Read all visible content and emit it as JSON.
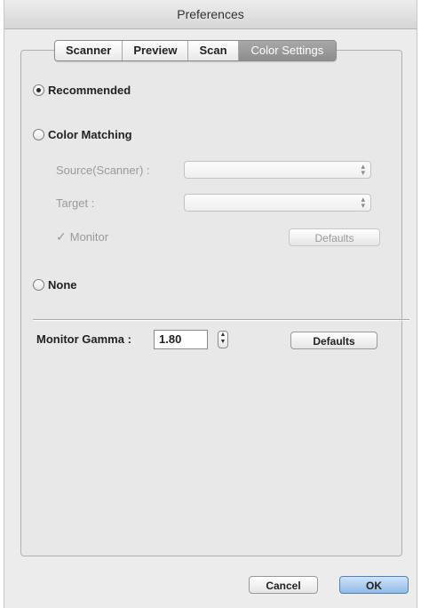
{
  "window": {
    "title": "Preferences"
  },
  "tabs": [
    {
      "label": "Scanner",
      "selected": false
    },
    {
      "label": "Preview",
      "selected": false
    },
    {
      "label": "Scan",
      "selected": false
    },
    {
      "label": "Color Settings",
      "selected": true
    }
  ],
  "color_settings": {
    "recommended": {
      "label": "Recommended",
      "selected": true
    },
    "color_matching": {
      "label": "Color Matching",
      "selected": false,
      "source_label": "Source(Scanner) :",
      "source_value": "",
      "target_label": "Target :",
      "target_value": "",
      "monitor_label": "Monitor",
      "monitor_checked": true,
      "defaults_label": "Defaults"
    },
    "none": {
      "label": "None",
      "selected": false
    }
  },
  "gamma": {
    "label": "Monitor Gamma :",
    "value": "1.80",
    "defaults_label": "Defaults"
  },
  "footer": {
    "cancel_label": "Cancel",
    "ok_label": "OK"
  }
}
